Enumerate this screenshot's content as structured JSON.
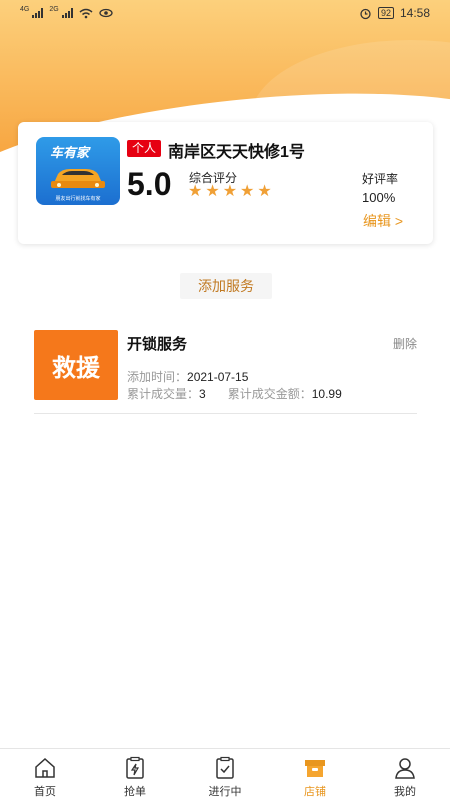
{
  "status_bar": {
    "net1": "4G",
    "net2": "2G",
    "battery": "92",
    "time": "14:58"
  },
  "shop": {
    "logo_title": "车有家",
    "logo_sub": "朋友出行就找车有家",
    "type_tag": "个人",
    "name": "南岸区天天快修1号",
    "score": "5.0",
    "score_label": "综合评分",
    "stars": 5,
    "good_rate_label": "好评率",
    "good_rate_value": "100%",
    "edit_label": "编辑 >"
  },
  "add_service_label": "添加服务",
  "services": [
    {
      "image_text": "救援",
      "name": "开锁服务",
      "delete_label": "删除",
      "added_time_label": "添加时间：",
      "added_time": "2021-07-15",
      "deal_count_label": "累计成交量：",
      "deal_count": "3",
      "deal_amount_label": "累计成交金额：",
      "deal_amount": "10.99"
    }
  ],
  "tabbar": {
    "items": [
      {
        "label": "首页",
        "icon": "home-icon"
      },
      {
        "label": "抢单",
        "icon": "grab-order-icon"
      },
      {
        "label": "进行中",
        "icon": "in-progress-icon"
      },
      {
        "label": "店铺",
        "icon": "shop-icon"
      },
      {
        "label": "我的",
        "icon": "profile-icon"
      }
    ],
    "active_color": "#e8961f"
  },
  "colors": {
    "accent": "#e8961f",
    "header_top": "#fcd07c",
    "header_bottom": "#f7a13a",
    "tag_red": "#e60012",
    "service_orange": "#f5781b"
  }
}
